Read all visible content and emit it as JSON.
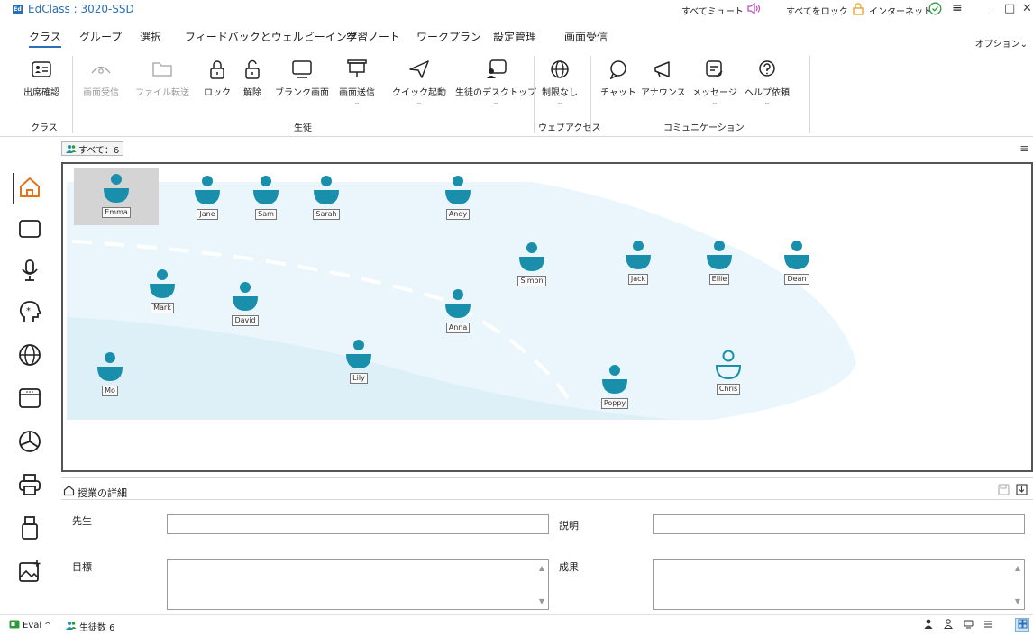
{
  "window": {
    "logo_text": "Ed",
    "title": "EdClass : 3020-SSD",
    "mute_all": "すべてミュート",
    "lock_all": "すべてをロック",
    "internet": "インターネット",
    "minimize": "_",
    "maximize": "□",
    "close": "✕"
  },
  "menu": {
    "tabs": [
      "クラス",
      "グループ",
      "選択",
      "フィードバックとウェルビーイング",
      "学習ノート",
      "ワークプラン",
      "設定管理",
      "画面受信"
    ],
    "active_tab": "クラス",
    "options": "オプション"
  },
  "ribbon": {
    "attendance": "出席確認",
    "screen_receive": "画面受信",
    "file_transfer": "ファイル転送",
    "lock": "ロック",
    "unlock": "解除",
    "blank_screen": "ブランク画面",
    "screen_send": "画面送信",
    "quick_launch": "クイック起動",
    "student_desktop": "生徒のデスクトップ",
    "no_restriction": "制限なし",
    "chat": "チャット",
    "announce": "アナウンス",
    "message": "メッセージ",
    "help_request": "ヘルプ依頼",
    "caret": "⌄",
    "group_class": "クラス",
    "group_students": "生徒",
    "group_web": "ウェブアクセス",
    "group_comm": "コミュニケーション"
  },
  "groupbar": {
    "chip": "すべて：6",
    "menu_icon": "≡"
  },
  "classroom": {
    "accent": "#1a8fab",
    "students": [
      {
        "name": "Emma",
        "selected": true,
        "online": true
      },
      {
        "name": "Jane",
        "online": true
      },
      {
        "name": "Sam",
        "online": true
      },
      {
        "name": "Sarah",
        "online": true
      },
      {
        "name": "Andy",
        "online": true
      },
      {
        "name": "Simon",
        "online": true
      },
      {
        "name": "Jack",
        "online": true
      },
      {
        "name": "Ellie",
        "online": true
      },
      {
        "name": "Dean",
        "online": true
      },
      {
        "name": "Mark",
        "online": true
      },
      {
        "name": "David",
        "online": true
      },
      {
        "name": "Anna",
        "online": true
      },
      {
        "name": "Mo",
        "online": true
      },
      {
        "name": "Lily",
        "online": true
      },
      {
        "name": "Poppy",
        "online": true
      },
      {
        "name": "Chris",
        "online": false
      }
    ]
  },
  "details": {
    "title": "授業の詳細",
    "teacher_label": "先生",
    "teacher_value": "",
    "description_label": "説明",
    "description_value": "",
    "goal_label": "目標",
    "goal_value": "",
    "result_label": "成果",
    "result_value": ""
  },
  "status": {
    "eval": "Eval",
    "student_count": "生徒数 6"
  }
}
